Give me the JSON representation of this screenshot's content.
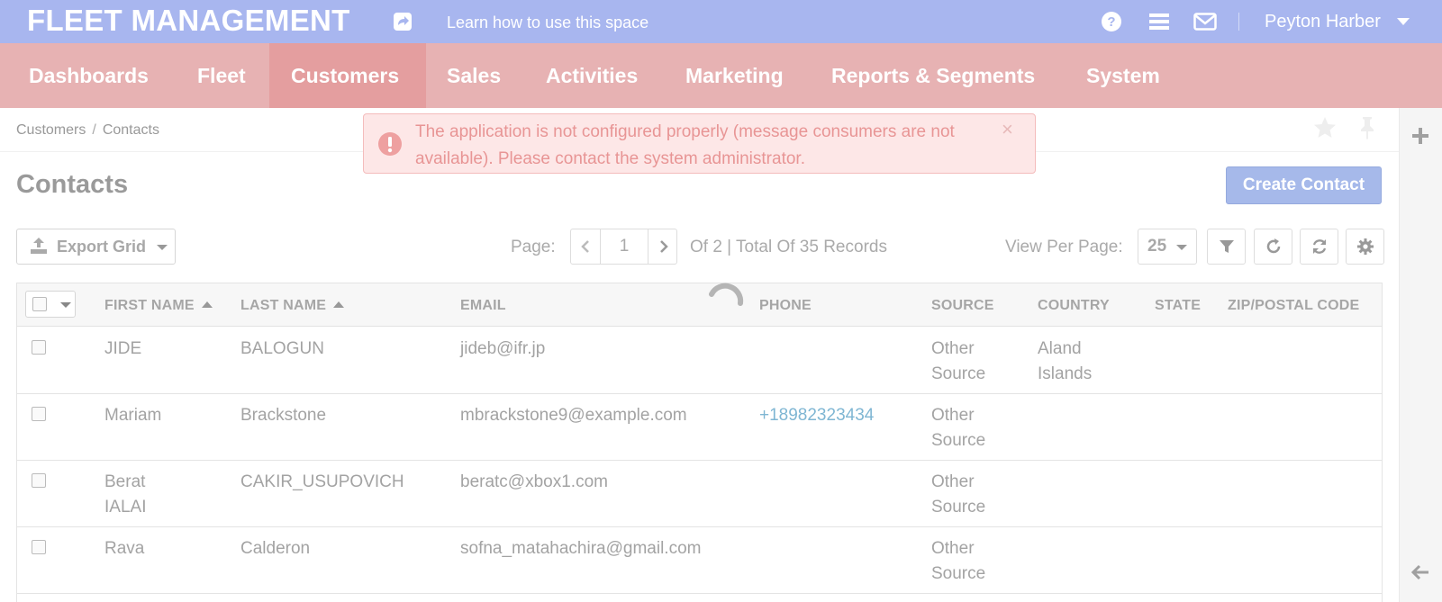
{
  "header": {
    "app_title": "FLEET MANAGEMENT",
    "learn_link": "Learn how to use this space",
    "user_name": "Peyton Harber"
  },
  "nav": {
    "items": [
      {
        "label": "Dashboards",
        "active": false
      },
      {
        "label": "Fleet",
        "active": false
      },
      {
        "label": "Customers",
        "active": true
      },
      {
        "label": "Sales",
        "active": false
      },
      {
        "label": "Activities",
        "active": false
      },
      {
        "label": "Marketing",
        "active": false
      },
      {
        "label": "Reports & Segments",
        "active": false
      },
      {
        "label": "System",
        "active": false
      }
    ]
  },
  "breadcrumb": {
    "items": [
      "Customers",
      "Contacts"
    ],
    "separator": "/"
  },
  "alert": {
    "message": "The application is not configured properly (message consumers are not available). Please contact the system administrator.",
    "close": "×"
  },
  "page": {
    "title": "Contacts",
    "create_button": "Create Contact"
  },
  "toolbar": {
    "export_label": "Export Grid",
    "page_label": "Page:",
    "current_page": "1",
    "pager_summary": "Of 2 | Total Of 35 Records",
    "view_per_page_label": "View Per Page:",
    "view_per_page_value": "25"
  },
  "grid": {
    "columns": [
      "FIRST NAME",
      "LAST NAME",
      "EMAIL",
      "PHONE",
      "SOURCE",
      "COUNTRY",
      "STATE",
      "ZIP/POSTAL CODE"
    ],
    "rows": [
      {
        "first": "JIDE",
        "last": "BALOGUN",
        "email": "jideb@ifr.jp",
        "phone": "",
        "source": "Other Source",
        "country": "Aland Islands",
        "state": "",
        "zip": ""
      },
      {
        "first": "Mariam",
        "last": "Brackstone",
        "email": "mbrackstone9@example.com",
        "phone": "+18982323434",
        "source": "Other Source",
        "country": "",
        "state": "",
        "zip": ""
      },
      {
        "first": "Berat IALAI",
        "last": "CAKIR_USUPOVICH",
        "email": "beratc@xbox1.com",
        "phone": "",
        "source": "Other Source",
        "country": "",
        "state": "",
        "zip": ""
      },
      {
        "first": "Rava",
        "last": "Calderon",
        "email": "sofna_matahachira@gmail.com",
        "phone": "",
        "source": "Other Source",
        "country": "",
        "state": "",
        "zip": ""
      }
    ]
  },
  "colors": {
    "topbar": "#a8b6ef",
    "mainnav": "#e7b2b3",
    "nav_active": "#e49e9f",
    "alert_bg": "#fde7e7",
    "alert_text": "#e89595",
    "primary_button": "#a6b9ea",
    "phone_link": "#7fb6d3"
  }
}
